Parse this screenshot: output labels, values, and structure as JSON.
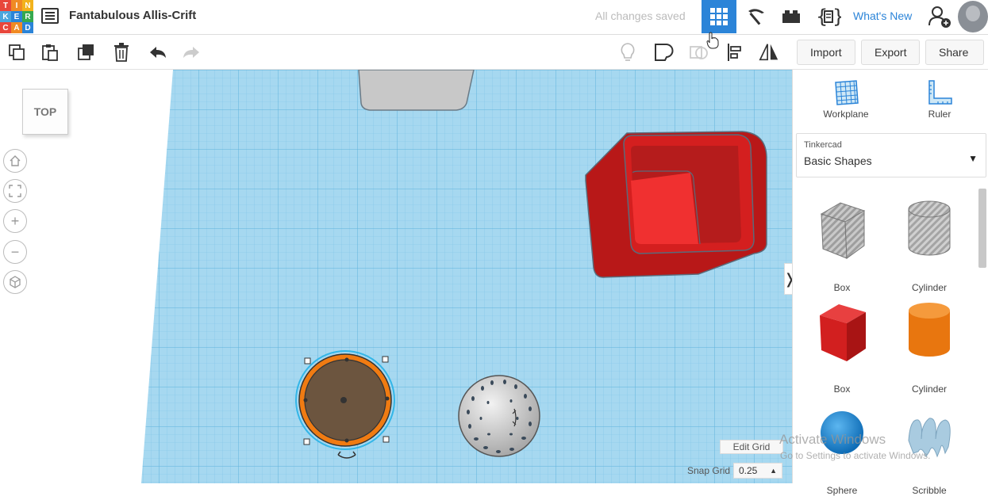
{
  "header": {
    "logo_letters": [
      "T",
      "I",
      "N",
      "K",
      "E",
      "R",
      "C",
      "A",
      "D"
    ],
    "logo_colors": [
      "#e8463b",
      "#f08a24",
      "#f2b21c",
      "#4aa6dd",
      "#2b84d8",
      "#36a94f",
      "#e8463b",
      "#f08a24",
      "#2b84d8"
    ],
    "project_title": "Fantabulous Allis-Crift",
    "save_status": "All changes saved",
    "whats_new": "What's New"
  },
  "toolbar": {
    "import_label": "Import",
    "export_label": "Export",
    "share_label": "Share"
  },
  "view": {
    "viewcube_label": "TOP"
  },
  "panel": {
    "workplane_label": "Workplane",
    "ruler_label": "Ruler",
    "library_provider": "Tinkercad",
    "library_name": "Basic Shapes",
    "shapes": [
      {
        "label": "Box",
        "kind": "box",
        "color": "#b8b8b8"
      },
      {
        "label": "Cylinder",
        "kind": "cylinder",
        "color": "#c4c4c4"
      },
      {
        "label": "Box",
        "kind": "box",
        "color": "#e02424"
      },
      {
        "label": "Cylinder",
        "kind": "cylinder",
        "color": "#f07b12"
      },
      {
        "label": "Sphere",
        "kind": "sphere",
        "color": "#1d8ad8"
      },
      {
        "label": "Scribble",
        "kind": "scribble",
        "color": "#9cc4dc"
      }
    ]
  },
  "grid": {
    "edit_grid_label": "Edit Grid",
    "snap_grid_label": "Snap Grid",
    "snap_grid_value": "0.25"
  },
  "watermark": {
    "line1": "Activate Windows",
    "line2": "Go to Settings to activate Windows."
  },
  "colors": {
    "accent": "#2b84d8",
    "workplane": "#a6d8f0",
    "grid_line": "#7fc4e6",
    "red_shape": "#e02424",
    "orange_ring": "#f07b12"
  }
}
